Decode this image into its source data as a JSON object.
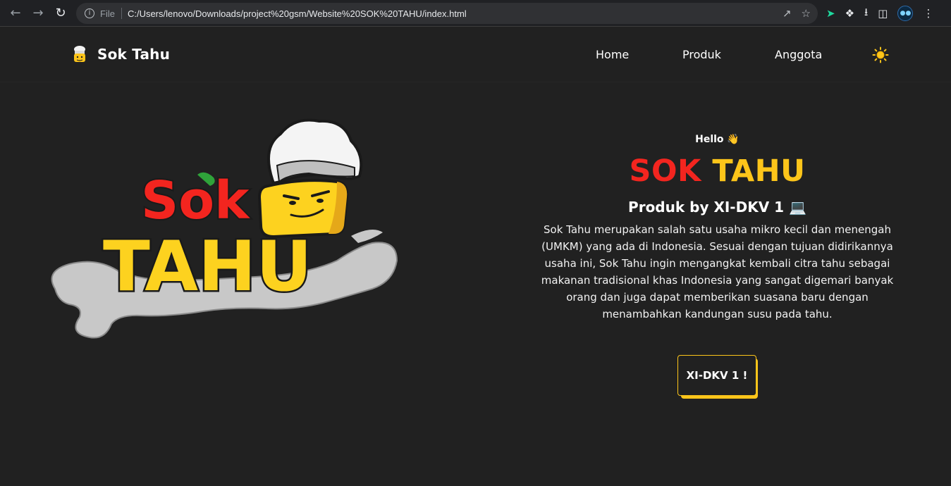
{
  "browser": {
    "protocol_label": "File",
    "url": "C:/Users/lenovo/Downloads/project%20gsm/Website%20SOK%20TAHU/index.html"
  },
  "header": {
    "brand_name": "Sok Tahu",
    "nav": [
      {
        "label": "Home"
      },
      {
        "label": "Produk"
      },
      {
        "label": "Anggota"
      }
    ]
  },
  "hero": {
    "greeting": "Hello 👋",
    "title_part1": "SOK",
    "title_part2": "TAHU",
    "subtitle": "Produk by XI-DKV 1 💻",
    "description": "Sok Tahu merupakan salah satu usaha mikro kecil dan menengah (UMKM) yang ada di Indonesia. Sesuai dengan tujuan didirikannya usaha ini, Sok Tahu ingin mengangkat kembali citra tahu sebagai makanan tradisional khas Indonesia yang sangat digemari banyak orang dan juga dapat memberikan suasana baru dengan menambahkan kandungan susu pada tahu.",
    "cta_label": "XI-DKV 1 !",
    "logo_text_top": "Sok",
    "logo_text_bottom": "TAHU"
  },
  "colors": {
    "background": "#212121",
    "red": "#f3251f",
    "yellow": "#fdc51a"
  }
}
